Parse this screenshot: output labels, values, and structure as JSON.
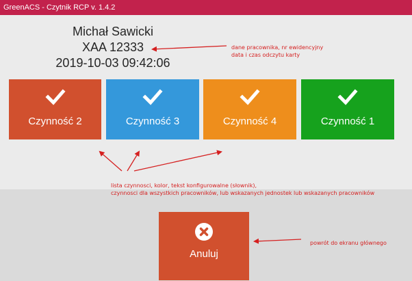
{
  "window": {
    "title": "GreenACS - Czytnik RCP v. 1.4.2"
  },
  "employee": {
    "name": "Michał Sawicki",
    "id": "XAA 12333",
    "timestamp": "2019-10-03 09:42:06"
  },
  "activities": [
    {
      "label": "Czynność 2",
      "color": "#d1502e",
      "icon": "checkmark-icon"
    },
    {
      "label": "Czynność 3",
      "color": "#3498db",
      "icon": "checkmark-icon"
    },
    {
      "label": "Czynność 4",
      "color": "#ee8e1c",
      "icon": "checkmark-icon"
    },
    {
      "label": "Czynność 1",
      "color": "#16a21d",
      "icon": "checkmark-icon"
    }
  ],
  "cancel": {
    "label": "Anuluj",
    "color": "#d1502e",
    "icon": "close-circle-icon"
  },
  "annotations": {
    "employee_line1": "dane pracownika, nr ewidencyjny",
    "employee_line2": "data i czas odczytu karty",
    "activities_line1": "lista czynnosci, kolor, tekst konfigurowalne (słownik),",
    "activities_line2": "czynnosci dla wszystkich pracowników, lub wskazanych jednostek lub wskazanych pracowników",
    "cancel": "powrót do ekranu głównego",
    "arrow_color": "#d52020"
  }
}
